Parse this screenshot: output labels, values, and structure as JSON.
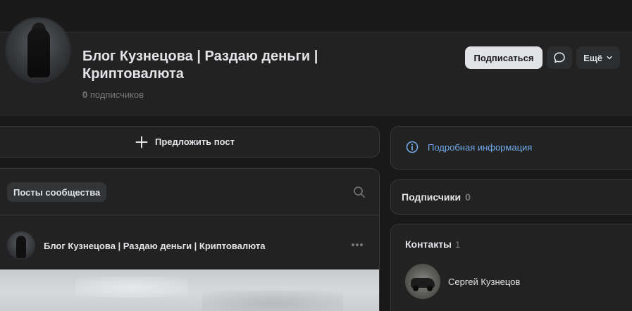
{
  "header": {
    "title": "Блог Кузнецова | Раздаю деньги | Криптовалюта",
    "subscribers_count": "0",
    "subscribers_label": "подписчиков",
    "subscribe_label": "Подписаться",
    "more_label": "Ещё"
  },
  "suggest": {
    "label": "Предложить пост"
  },
  "posts": {
    "tab_label": "Посты сообщества",
    "post": {
      "author": "Блог Кузнецова | Раздаю деньги | Криптовалюта"
    }
  },
  "info": {
    "link_label": "Подробная информация"
  },
  "subscribers": {
    "title": "Подписчики",
    "count": "0"
  },
  "contacts": {
    "title": "Контакты",
    "count": "1",
    "items": [
      {
        "name": "Сергей Кузнецов"
      }
    ]
  },
  "colors": {
    "background": "#191919",
    "card": "#222222",
    "accent_link": "#71aaeb",
    "primary_button": "#e1e3e6"
  },
  "icons": [
    "message-icon",
    "chevron-down-icon",
    "plus-icon",
    "search-icon",
    "more-horizontal-icon",
    "info-icon"
  ]
}
